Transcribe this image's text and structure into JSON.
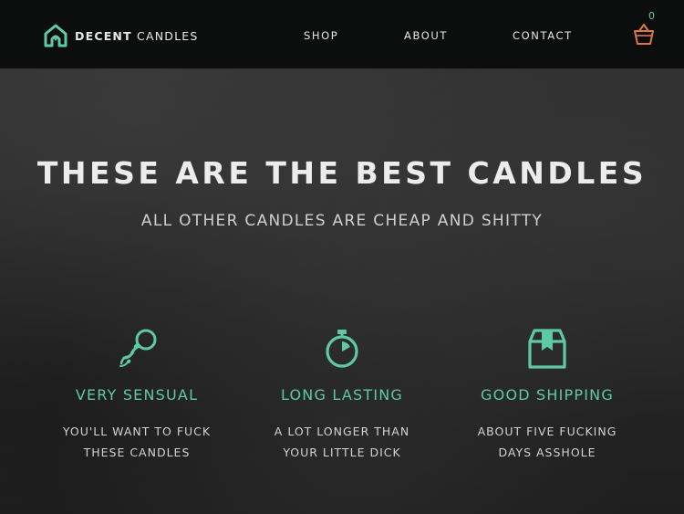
{
  "brand": {
    "name_bold": "DECENT",
    "name_light": "CANDLES",
    "logo_icon": "candle-house-icon"
  },
  "nav": {
    "items": [
      {
        "label": "SHOP"
      },
      {
        "label": "ABOUT"
      },
      {
        "label": "CONTACT"
      }
    ],
    "cart": {
      "icon": "basket-icon",
      "count": "0"
    }
  },
  "hero": {
    "title": "THESE ARE THE BEST CANDLES",
    "subtitle": "ALL OTHER CANDLES ARE CHEAP AND SHITTY"
  },
  "features": [
    {
      "icon": "sperm-icon",
      "title": "VERY SENSUAL",
      "line1": "YOU'LL WANT TO FUCK",
      "line2": "THESE CANDLES"
    },
    {
      "icon": "stopwatch-icon",
      "title": "LONG LASTING",
      "line1": "A LOT LONGER THAN",
      "line2": "YOUR LITTLE DICK"
    },
    {
      "icon": "box-icon",
      "title": "GOOD SHIPPING",
      "line1": "ABOUT FIVE FUCKING",
      "line2": "DAYS ASSHOLE"
    }
  ],
  "colors": {
    "accent": "#5fc9a6",
    "navbar": "#0c0e0d",
    "cart": "#d9774a",
    "text": "#ececec"
  }
}
